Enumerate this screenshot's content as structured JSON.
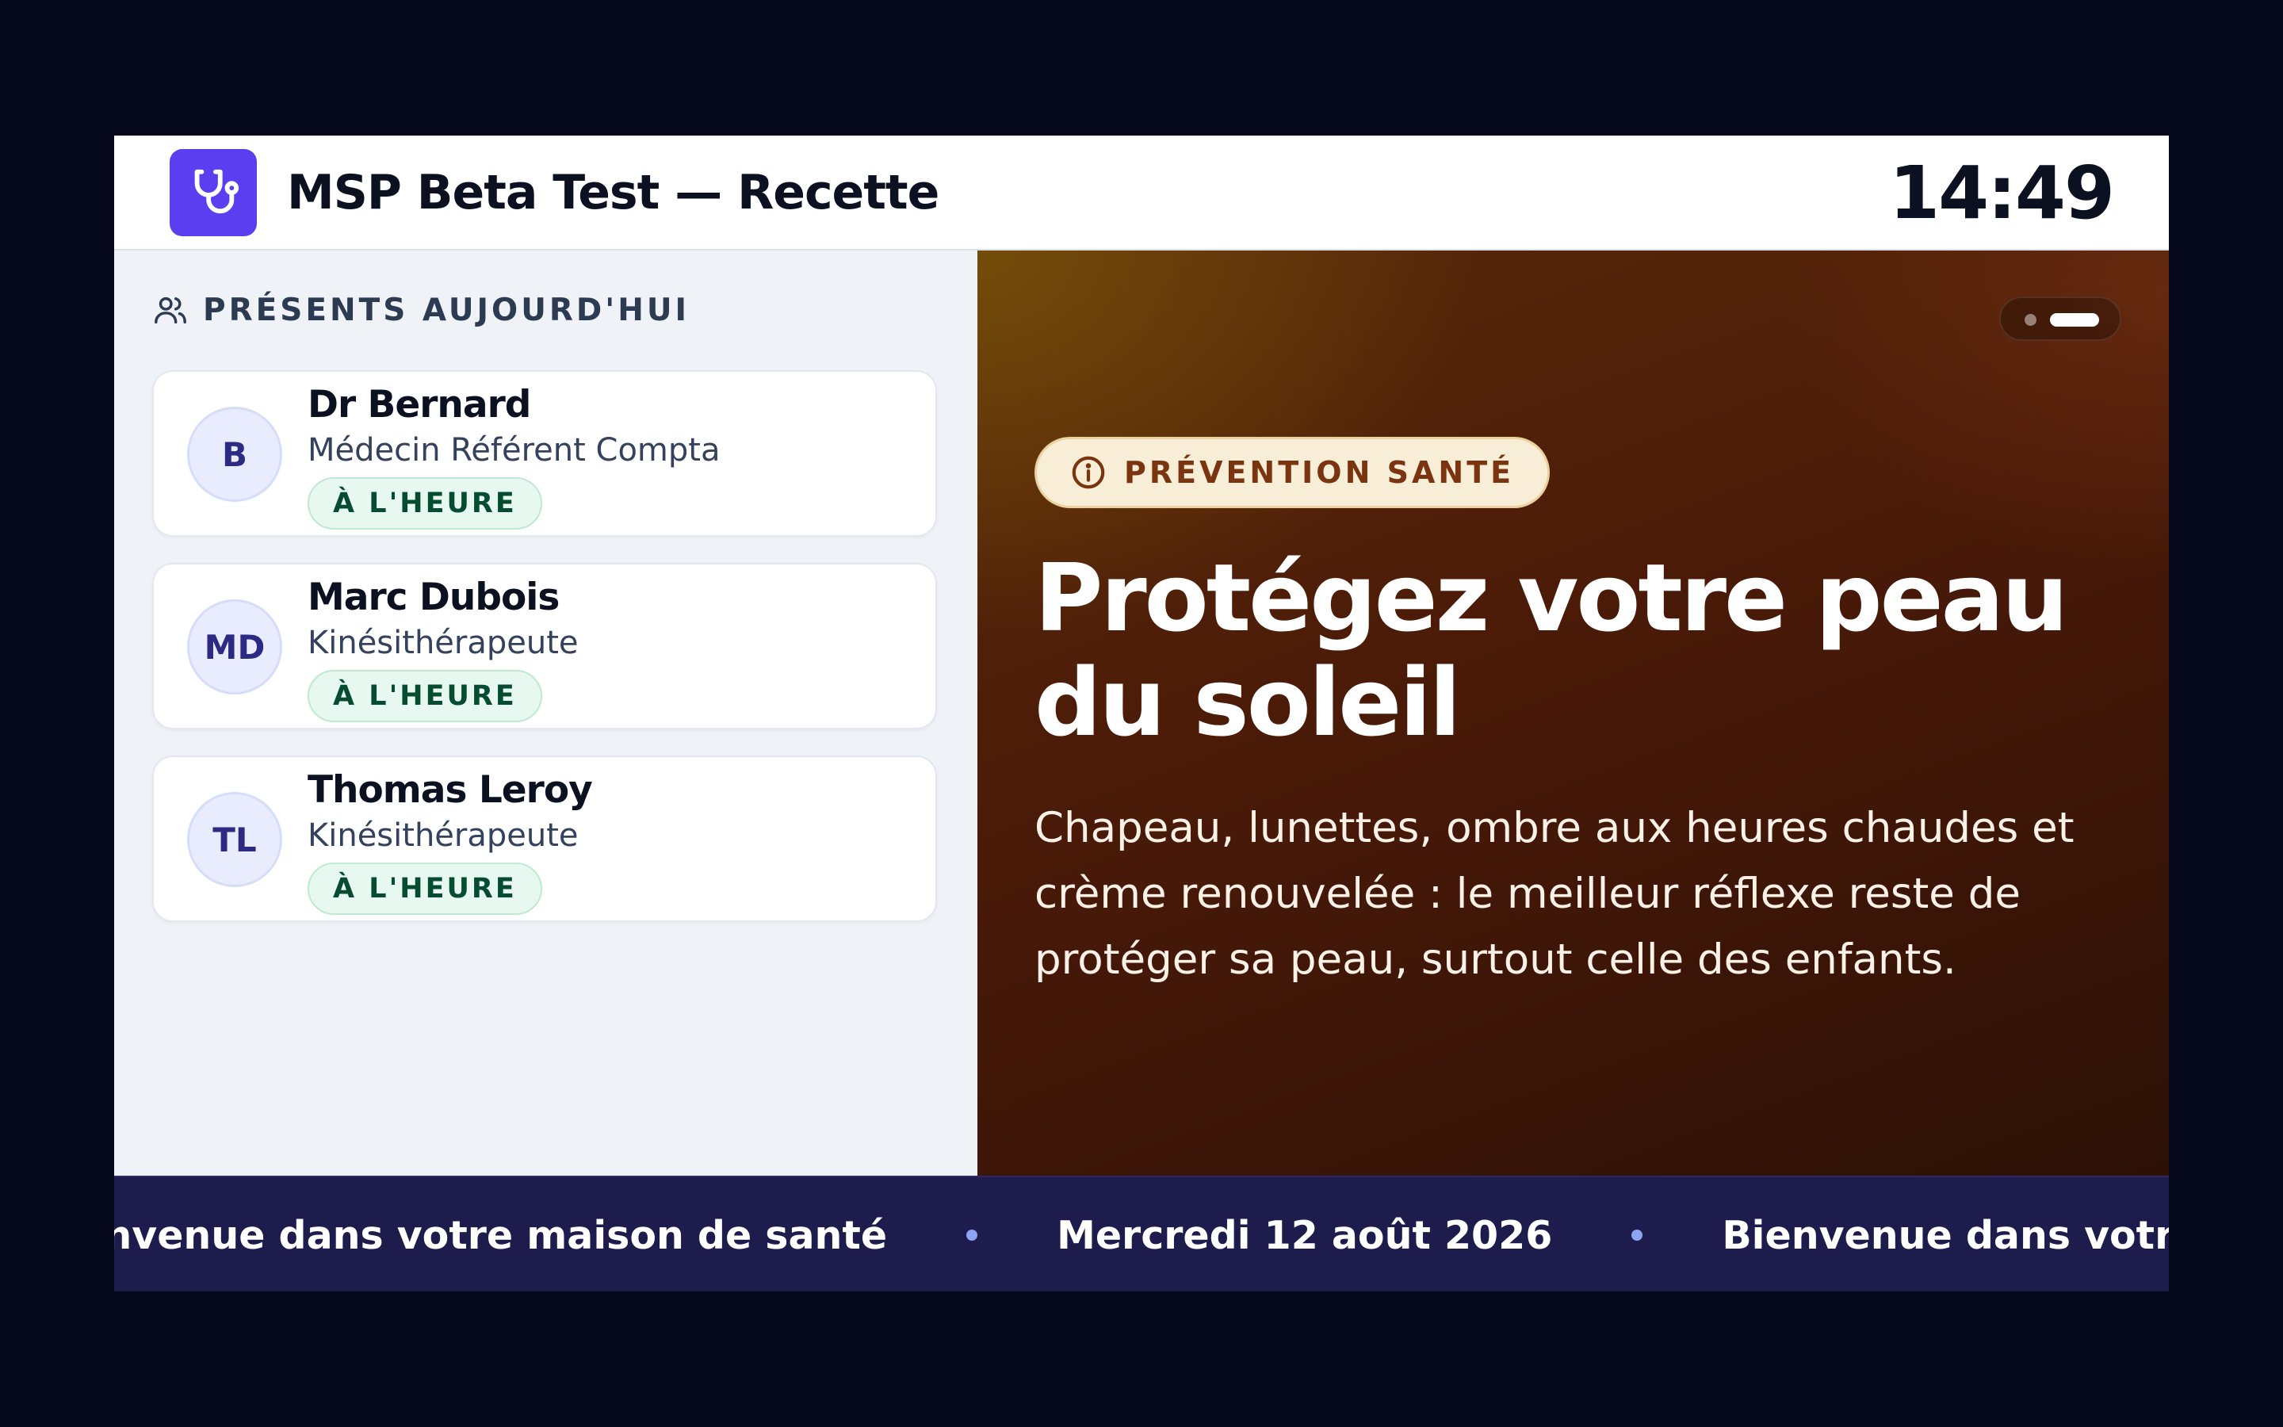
{
  "header": {
    "logo_icon": "stethoscope-icon",
    "title": "MSP Beta Test — Recette",
    "clock": "14:49"
  },
  "sidebar": {
    "heading_icon": "users-icon",
    "heading": "PRÉSENTS AUJOURD'HUI",
    "staff": [
      {
        "initials": "B",
        "name": "Dr Bernard",
        "role": "Médecin Référent Compta",
        "status": "À L'HEURE"
      },
      {
        "initials": "MD",
        "name": "Marc Dubois",
        "role": "Kinésithérapeute",
        "status": "À L'HEURE"
      },
      {
        "initials": "TL",
        "name": "Thomas Leroy",
        "role": "Kinésithérapeute",
        "status": "À L'HEURE"
      }
    ]
  },
  "slide": {
    "category_icon": "info-icon",
    "category": "PRÉVENTION SANTÉ",
    "title": "Protégez votre peau du soleil",
    "body": "Chapeau, lunettes, ombre aux heures chaudes et crème renouvelée : le meilleur réflexe reste de protéger sa peau, surtout celle des enfants.",
    "slide_count": 2,
    "active_slide": 2
  },
  "ticker": {
    "items": [
      "Bienvenue dans votre maison de santé",
      "Mercredi 12 août 2026",
      "Bienvenue dans votre maison de santé"
    ]
  },
  "colors": {
    "accent": "#5a3ef0",
    "status_ok_bg": "#e6f8ef",
    "status_ok_text": "#064b34",
    "ticker_bg": "#1e1b4d",
    "category_text": "#7a3510"
  }
}
